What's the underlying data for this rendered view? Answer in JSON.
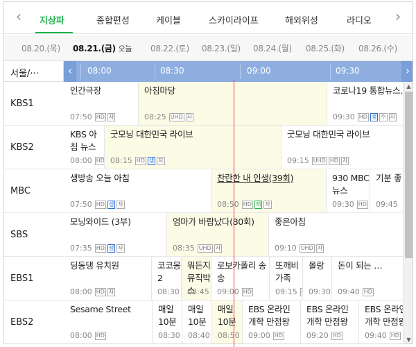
{
  "categories": {
    "prev_icon": "chevron-left-icon",
    "next_icon": "chevron-right-icon",
    "tabs": [
      "지상파",
      "종합편성",
      "케이블",
      "스카이라이프",
      "해외위성",
      "라디오"
    ],
    "active_index": 0,
    "accent": "#1fb24a"
  },
  "dates": {
    "items": [
      "08.20.(목)",
      "08.21.(금)",
      "08.22.(토)",
      "08.23.(일)",
      "08.24.(월)",
      "08.25.(화)",
      "08.26.(수)"
    ],
    "active_index": 1,
    "today_label": "오늘"
  },
  "timeline": {
    "region": "서울/···",
    "times": [
      "08:00",
      "08:30",
      "09:00",
      "09:30"
    ],
    "bar_color": "#8eaee0",
    "now_line_color": "#e03535"
  },
  "channels": [
    "KBS1",
    "KBS2",
    "MBC",
    "SBS",
    "EBS1",
    "EBS2"
  ],
  "programs": [
    [
      {
        "title": "인간극장",
        "time": "07:50",
        "badges": [
          "HD",
          "자"
        ],
        "live": false
      },
      {
        "title": "아침마당",
        "time": "08:25",
        "badges": [
          "UHD",
          "자"
        ],
        "live": true
      },
      {
        "title": "코로나19 통합뉴스…",
        "time": "09:30",
        "badges": [
          "HD",
          "생",
          "수",
          "자"
        ],
        "live": false
      }
    ],
    [
      {
        "title": "KBS 아침 뉴스",
        "time": "08:00",
        "badges": [
          "HD"
        ],
        "live": false
      },
      {
        "title": "굿모닝 대한민국 라이브",
        "time": "08:15",
        "badges": [
          "HD",
          "생",
          "자"
        ],
        "live": true
      },
      {
        "title": "굿모닝 대한민국 라이브",
        "time": "09:15",
        "badges": [
          "UHD",
          "HD",
          "자"
        ],
        "live": false
      }
    ],
    [
      {
        "title": "생방송 오늘 아침",
        "time": "07:50",
        "badges": [
          "HD",
          "생",
          "자"
        ],
        "live": false
      },
      {
        "title": "찬란한 내 인생(39회)",
        "time": "08:50",
        "badges": [
          "HD",
          "재",
          "자"
        ],
        "live": true,
        "link": true
      },
      {
        "title": "930 MBC 뉴스",
        "time": "09:30",
        "badges": [
          "HD"
        ],
        "live": false
      },
      {
        "title": "기분 좋",
        "time": "09:45",
        "badges": [],
        "live": false
      }
    ],
    [
      {
        "title": "모닝와이드 (3부)",
        "time": "07:35",
        "badges": [
          "HD",
          "생",
          "자"
        ],
        "live": false
      },
      {
        "title": "엄마가 바람났다(80회)",
        "time": "08:35",
        "badges": [
          "UHD",
          "자"
        ],
        "live": true
      },
      {
        "title": "좋은아침",
        "time": "09:10",
        "badges": [
          "UHD",
          "자"
        ],
        "live": false
      }
    ],
    [
      {
        "title": "딩동댕 유치원",
        "time": "08:00",
        "badges": [
          "HD",
          "자"
        ],
        "live": false
      },
      {
        "title": "코코몽2",
        "time": "08:30",
        "badges": [
          "HD"
        ],
        "live": false
      },
      {
        "title": "뭐든지 뮤직박스",
        "time": "08:45",
        "badges": [
          "HD"
        ],
        "live": true
      },
      {
        "title": "로보카폴리 송송",
        "time": "09:00",
        "badges": [
          "HD"
        ],
        "live": false
      },
      {
        "title": "또깨비 가족",
        "time": "09:15",
        "badges": [
          "HD"
        ],
        "live": false
      },
      {
        "title": "몰랑",
        "time": "09:30",
        "badges": [],
        "live": false
      },
      {
        "title": "돈이 되는 …",
        "time": "09:40",
        "badges": [
          "HD"
        ],
        "live": false
      }
    ],
    [
      {
        "title": "Sesame Street",
        "time": "08:00",
        "badges": [
          "HD"
        ],
        "live": false
      },
      {
        "title": "매일 10분",
        "time": "08:30",
        "badges": [],
        "live": false
      },
      {
        "title": "매일 10분",
        "time": "08:40",
        "badges": [],
        "live": false
      },
      {
        "title": "매일 10분",
        "time": "08:50",
        "badges": [],
        "live": true
      },
      {
        "title": "EBS 온라인 개학 만점왕",
        "time": "09:00",
        "badges": [
          "HD"
        ],
        "live": false
      },
      {
        "title": "EBS 온라인 개학 만점왕",
        "time": "09:20",
        "badges": [
          "HD"
        ],
        "live": false
      },
      {
        "title": "EBS 온라인 개학 만점왕",
        "time": "09:40",
        "badges": [
          "HD"
        ],
        "live": false
      }
    ]
  ]
}
